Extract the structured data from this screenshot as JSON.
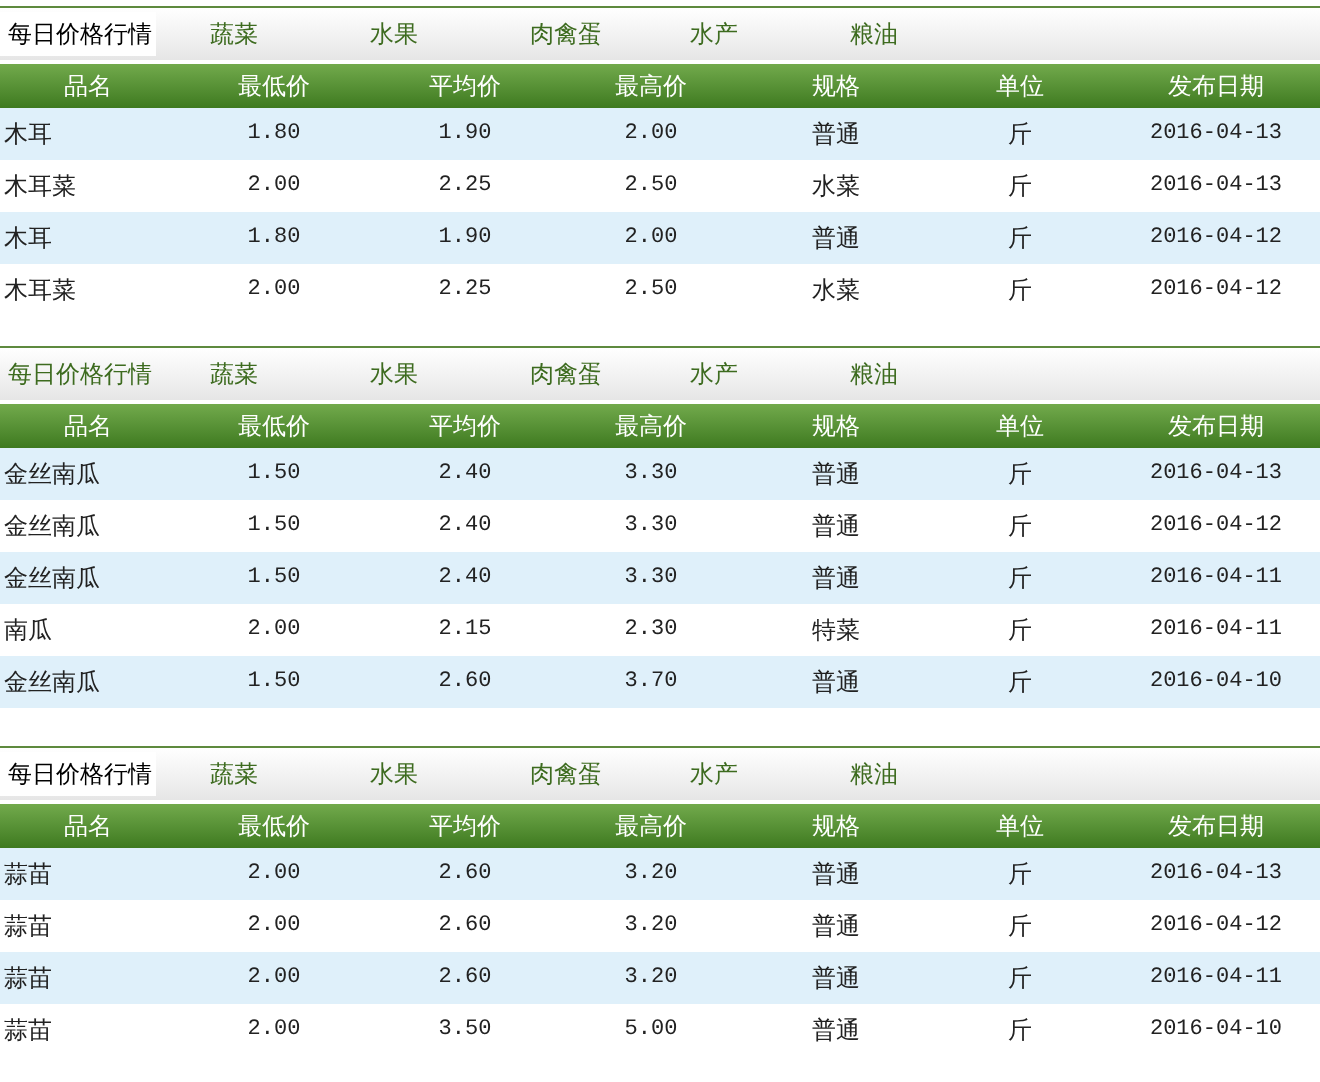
{
  "panels": [
    {
      "tabs": [
        {
          "label": "每日价格行情",
          "selected": true
        },
        {
          "label": "蔬菜",
          "selected": false
        },
        {
          "label": "水果",
          "selected": false
        },
        {
          "label": "肉禽蛋",
          "selected": false
        },
        {
          "label": "水产",
          "selected": false
        },
        {
          "label": "粮油",
          "selected": false
        }
      ],
      "columns": [
        "品名",
        "最低价",
        "平均价",
        "最高价",
        "规格",
        "单位",
        "发布日期"
      ],
      "rows": [
        {
          "cells": [
            "木耳",
            "1.80",
            "1.90",
            "2.00",
            "普通",
            "斤",
            "2016-04-13"
          ]
        },
        {
          "cells": [
            "木耳菜",
            "2.00",
            "2.25",
            "2.50",
            "水菜",
            "斤",
            "2016-04-13"
          ]
        },
        {
          "cells": [
            "木耳",
            "1.80",
            "1.90",
            "2.00",
            "普通",
            "斤",
            "2016-04-12"
          ]
        },
        {
          "cells": [
            "木耳菜",
            "2.00",
            "2.25",
            "2.50",
            "水菜",
            "斤",
            "2016-04-12"
          ]
        }
      ]
    },
    {
      "tabs": [
        {
          "label": "每日价格行情",
          "selected": false
        },
        {
          "label": "蔬菜",
          "selected": false
        },
        {
          "label": "水果",
          "selected": false
        },
        {
          "label": "肉禽蛋",
          "selected": false
        },
        {
          "label": "水产",
          "selected": false
        },
        {
          "label": "粮油",
          "selected": false
        }
      ],
      "columns": [
        "品名",
        "最低价",
        "平均价",
        "最高价",
        "规格",
        "单位",
        "发布日期"
      ],
      "rows": [
        {
          "cells": [
            "金丝南瓜",
            "1.50",
            "2.40",
            "3.30",
            "普通",
            "斤",
            "2016-04-13"
          ]
        },
        {
          "cells": [
            "金丝南瓜",
            "1.50",
            "2.40",
            "3.30",
            "普通",
            "斤",
            "2016-04-12"
          ]
        },
        {
          "cells": [
            "金丝南瓜",
            "1.50",
            "2.40",
            "3.30",
            "普通",
            "斤",
            "2016-04-11"
          ]
        },
        {
          "cells": [
            "南瓜",
            "2.00",
            "2.15",
            "2.30",
            "特菜",
            "斤",
            "2016-04-11"
          ]
        },
        {
          "cells": [
            "金丝南瓜",
            "1.50",
            "2.60",
            "3.70",
            "普通",
            "斤",
            "2016-04-10"
          ]
        }
      ]
    },
    {
      "tabs": [
        {
          "label": "每日价格行情",
          "selected": true
        },
        {
          "label": "蔬菜",
          "selected": false
        },
        {
          "label": "水果",
          "selected": false
        },
        {
          "label": "肉禽蛋",
          "selected": false
        },
        {
          "label": "水产",
          "selected": false
        },
        {
          "label": "粮油",
          "selected": false
        }
      ],
      "columns": [
        "品名",
        "最低价",
        "平均价",
        "最高价",
        "规格",
        "单位",
        "发布日期"
      ],
      "rows": [
        {
          "cells": [
            "蒜苗",
            "2.00",
            "2.60",
            "3.20",
            "普通",
            "斤",
            "2016-04-13"
          ]
        },
        {
          "cells": [
            "蒜苗",
            "2.00",
            "2.60",
            "3.20",
            "普通",
            "斤",
            "2016-04-12"
          ]
        },
        {
          "cells": [
            "蒜苗",
            "2.00",
            "2.60",
            "3.20",
            "普通",
            "斤",
            "2016-04-11"
          ]
        },
        {
          "cells": [
            "蒜苗",
            "2.00",
            "3.50",
            "5.00",
            "普通",
            "斤",
            "2016-04-10"
          ]
        }
      ]
    }
  ]
}
